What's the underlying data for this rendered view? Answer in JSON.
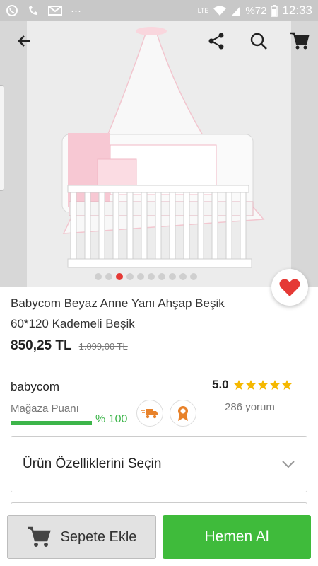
{
  "status_bar": {
    "battery": "%72",
    "time": "12:33",
    "network": "LTE",
    "icons": [
      "whatsapp-icon",
      "missed-call-icon",
      "mail-icon",
      "more-icon",
      "signal-icon",
      "wifi-icon",
      "battery-icon"
    ]
  },
  "hero": {
    "slide_count": 10,
    "active_slide": 3
  },
  "product": {
    "title_line1": "Babycom Beyaz Anne Yanı Ahşap Beşik",
    "title_line2": "60*120 Kademeli Beşik",
    "price": "850,25 TL",
    "old_price": "1.099,00 TL"
  },
  "seller": {
    "name": "babycom",
    "store_label": "Mağaza Puanı",
    "score": "% 100",
    "score_fraction": 1.0,
    "badges": [
      "fast-delivery-icon",
      "quality-medal-icon"
    ]
  },
  "rating": {
    "value": "5.0",
    "stars": 5,
    "reviews": "286 yorum"
  },
  "options": {
    "label": "Ürün Özelliklerini Seçin"
  },
  "actions": {
    "add_to_cart": "Sepete Ekle",
    "buy_now": "Hemen Al"
  },
  "colors": {
    "accent_green": "#3fbb3b",
    "heart_red": "#e53935",
    "star_gold": "#f5b800"
  }
}
